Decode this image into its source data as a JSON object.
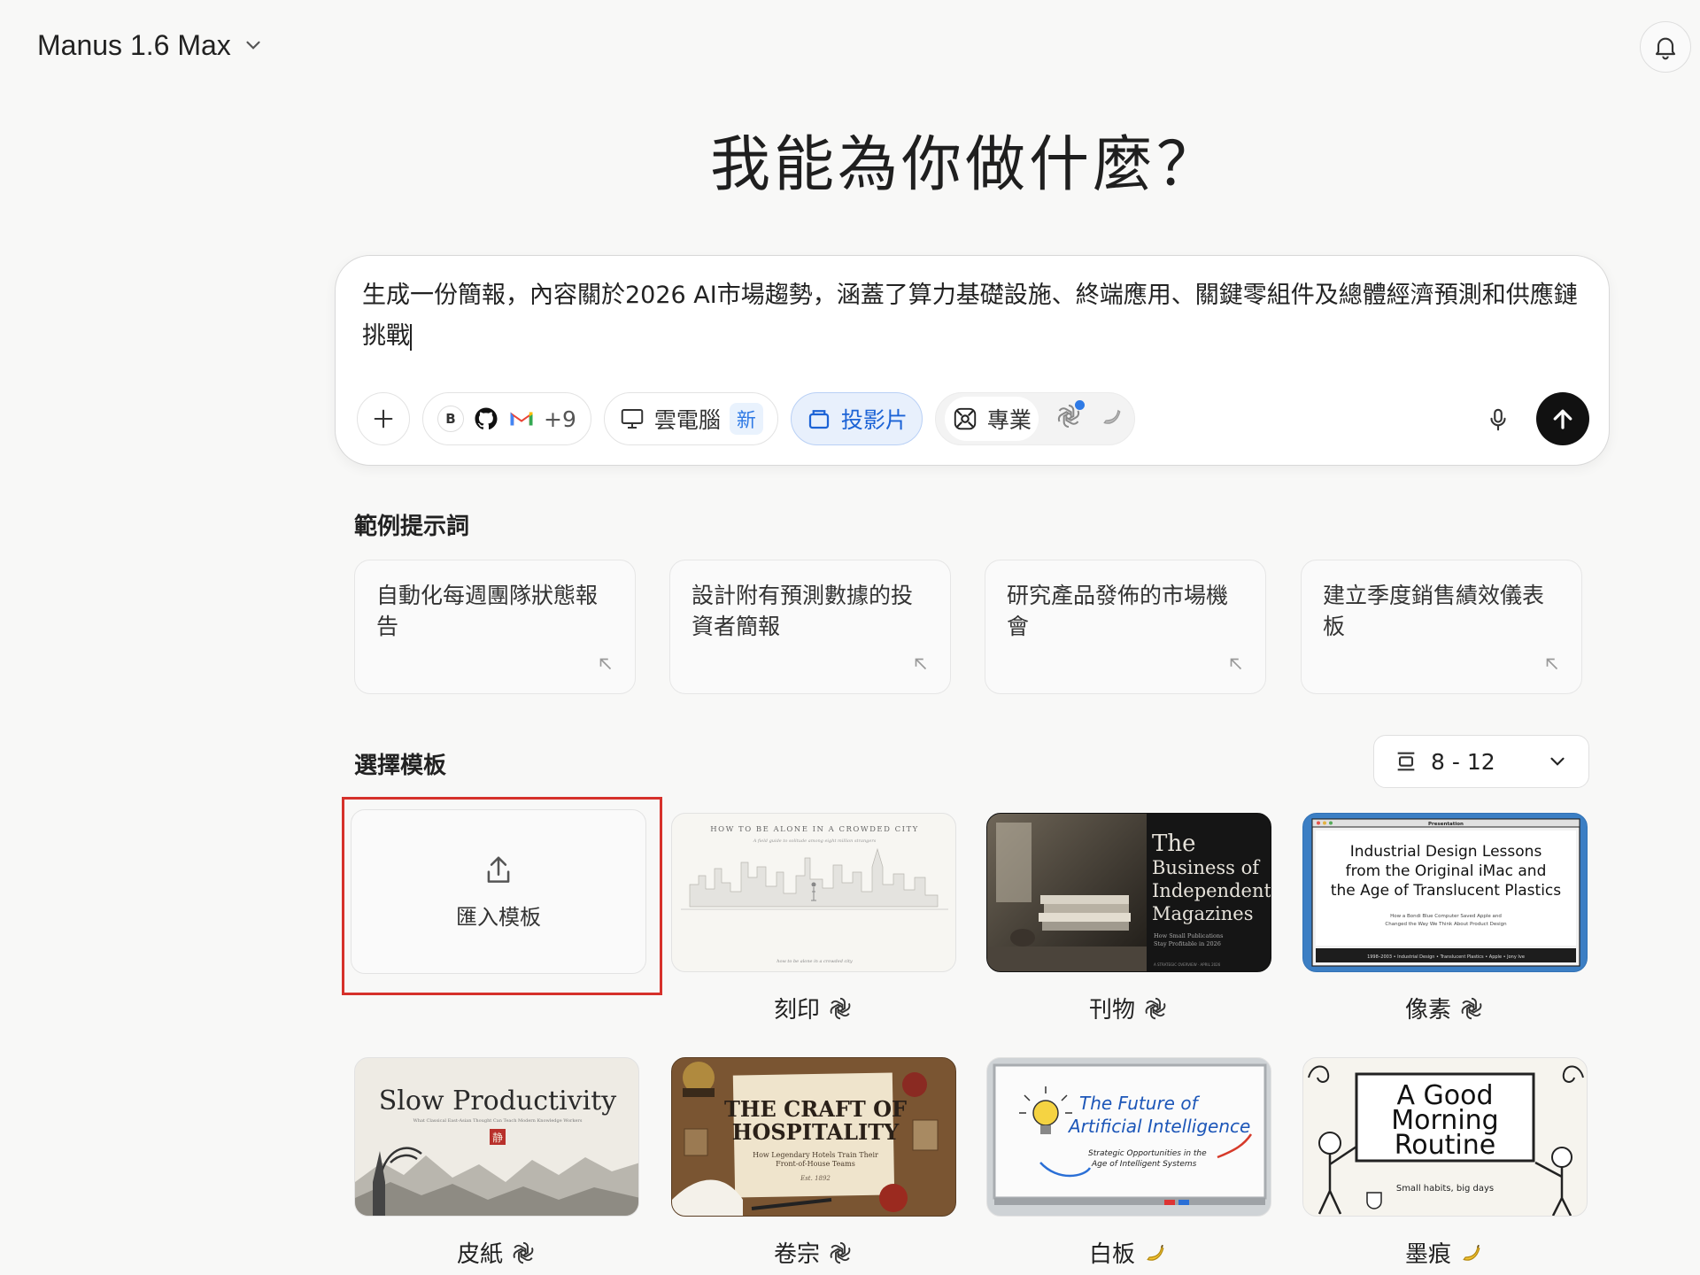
{
  "header": {
    "model_label": "Manus 1.6 Max"
  },
  "headline": "我能為你做什麼？",
  "composer": {
    "prompt": "生成一份簡報，內容關於2026 AI市場趨勢，涵蓋了算力基礎設施、終端應用、關鍵零組件及總體經濟預測和供應鏈挑戰",
    "connector_badge": "B",
    "connector_more": "+9",
    "cloud_pc_label": "雲電腦",
    "new_tag": "新",
    "slides_label": "投影片",
    "pro_label": "專業"
  },
  "examples": {
    "title": "範例提示詞",
    "items": [
      "自動化每週團隊狀態報告",
      "設計附有預測數據的投資者簡報",
      "研究產品發佈的市場機會",
      "建立季度銷售績效儀表板"
    ]
  },
  "templates": {
    "title": "選擇模板",
    "slide_range": "8 - 12",
    "import_label": "匯入模板",
    "items": [
      {
        "name": "刻印",
        "badge": "openai"
      },
      {
        "name": "刊物",
        "badge": "openai"
      },
      {
        "name": "像素",
        "badge": "openai"
      },
      {
        "name": "皮紙",
        "badge": "openai"
      },
      {
        "name": "卷宗",
        "badge": "openai"
      },
      {
        "name": "白板",
        "badge": "banana"
      },
      {
        "name": "墨痕",
        "badge": "banana"
      }
    ],
    "thumbs": {
      "kezhi_top": "HOW TO BE ALONE IN A CROWDED CITY",
      "kezhi_sub": "A field guide to solitude among eight million strangers",
      "kezhi_bottom": "how to be alone in a crowded city",
      "mag_title": [
        "The",
        "Business of",
        "Independent",
        "Magazines"
      ],
      "mag_sub": [
        "How Small Publications",
        "Stay Profitable in 2026"
      ],
      "mag_footer": "A STRATEGIC OVERVIEW · APRIL 2026",
      "pixel_window": "Presentation",
      "pixel_title": [
        "Industrial Design Lessons",
        "from the Original iMac and",
        "the Age of Translucent Plastics"
      ],
      "pixel_sub": [
        "How a Bondi Blue Computer Saved Apple and",
        "Changed the Way We Think About Product Design"
      ],
      "pixel_footer": "1998–2003  •  Industrial Design  •  Translucent Plastics  •  Apple  •  Jony Ive",
      "slow_title": "Slow Productivity",
      "slow_sub": "What Classical East-Asian Thought Can Teach Modern Knowledge Workers",
      "slow_seal": "静",
      "craft_title": [
        "THE CRAFT OF",
        "HOSPITALITY"
      ],
      "craft_sub": [
        "How Legendary Hotels Train Their",
        "Front-of-House Teams"
      ],
      "craft_est": "Est. 1892",
      "wb_title": [
        "The Future of",
        "Artificial Intelligence"
      ],
      "wb_sub": [
        "Strategic Opportunities in the",
        "Age of Intelligent Systems"
      ],
      "ink_title": [
        "A Good",
        "Morning",
        "Routine"
      ],
      "ink_sub": "Small habits, big days"
    }
  }
}
